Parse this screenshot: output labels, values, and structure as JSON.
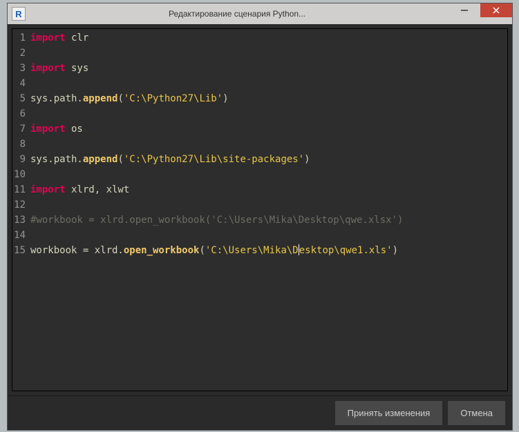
{
  "window": {
    "title": "Редактирование сценария Python...",
    "app_icon_letter": "R"
  },
  "code": {
    "lines": [
      {
        "n": 1,
        "tokens": [
          [
            "kw",
            "import"
          ],
          [
            "txt",
            " clr"
          ]
        ]
      },
      {
        "n": 2,
        "tokens": []
      },
      {
        "n": 3,
        "tokens": [
          [
            "kw",
            "import"
          ],
          [
            "txt",
            " sys"
          ]
        ]
      },
      {
        "n": 4,
        "tokens": []
      },
      {
        "n": 5,
        "tokens": [
          [
            "txt",
            "sys.path."
          ],
          [
            "fn",
            "append"
          ],
          [
            "txt",
            "("
          ],
          [
            "str",
            "'C:\\Python27\\Lib'"
          ],
          [
            "txt",
            ")"
          ]
        ]
      },
      {
        "n": 6,
        "tokens": []
      },
      {
        "n": 7,
        "tokens": [
          [
            "kw",
            "import"
          ],
          [
            "txt",
            " os"
          ]
        ]
      },
      {
        "n": 8,
        "tokens": []
      },
      {
        "n": 9,
        "tokens": [
          [
            "txt",
            "sys.path."
          ],
          [
            "fn",
            "append"
          ],
          [
            "txt",
            "("
          ],
          [
            "str",
            "'C:\\Python27\\Lib\\site-packages'"
          ],
          [
            "txt",
            ")"
          ]
        ]
      },
      {
        "n": 10,
        "tokens": []
      },
      {
        "n": 11,
        "tokens": [
          [
            "kw",
            "import"
          ],
          [
            "txt",
            " xlrd, xlwt"
          ]
        ]
      },
      {
        "n": 12,
        "tokens": []
      },
      {
        "n": 13,
        "tokens": [
          [
            "cmt",
            "#workbook = xlrd.open_workbook('C:\\Users\\Mika\\Desktop\\qwe.xlsx')"
          ]
        ]
      },
      {
        "n": 14,
        "tokens": []
      },
      {
        "n": 15,
        "tokens": [
          [
            "txt",
            "workbook = xlrd."
          ],
          [
            "fn",
            "open_workbook"
          ],
          [
            "txt",
            "("
          ],
          [
            "str",
            "'C:\\Users\\Mika\\D"
          ],
          [
            "cursor",
            ""
          ],
          [
            "str",
            "esktop\\qwe1.xls'"
          ],
          [
            "txt",
            ")"
          ]
        ]
      }
    ]
  },
  "footer": {
    "accept": "Принять изменения",
    "cancel": "Отмена"
  }
}
